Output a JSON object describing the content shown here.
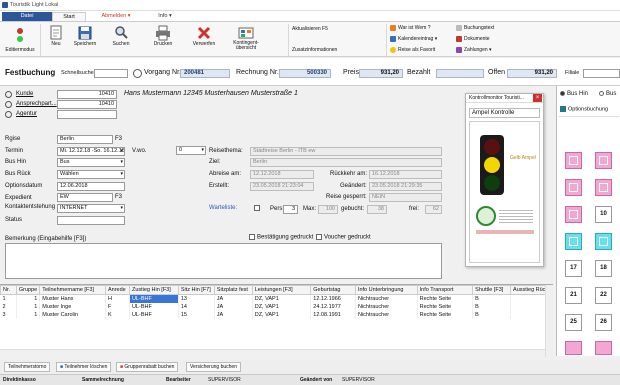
{
  "window": {
    "title": "Touristik Light Lokal"
  },
  "menu": {
    "tabs": [
      "Datei",
      "Start",
      "Abmelden",
      "Info"
    ]
  },
  "ribbon": {
    "editmode": "Editiermodus",
    "buttons": [
      "Neu",
      "Speichern",
      "Suchen",
      "Drucken",
      "Verwerfen",
      "Kontingent-\nübersicht"
    ],
    "mid_items": [
      "Aktualisieren F5",
      "Zusatzinformationen"
    ],
    "right_col1": [
      "War ist Wem ?",
      "Kalendereintrag",
      "Reise als Favorit"
    ],
    "right_col2": [
      "Buchungstext",
      "Dokumente",
      "Zahlungen"
    ]
  },
  "toolbar": {
    "festbuchung": "Festbuchung",
    "schnellsuche_label": "Schnellsuche",
    "schnellsuche_value": "",
    "vorgang_label": "Vorgang Nr.",
    "vorgang_value": "200481",
    "rechnung_label": "Rechnung Nr.",
    "rechnung_value": "500330",
    "preis_label": "Preis",
    "preis_value": "931,20",
    "bezahlt_label": "Bezahlt",
    "bezahlt_value": "",
    "offen_label": "Offen",
    "offen_value": "931,20",
    "filiale_label": "Filiale"
  },
  "form": {
    "kunde_label": "Kunde",
    "kunde_value": "10410",
    "kunde_info": "Hans Mustermann 12345 Musterhausen Musterstraße 1",
    "ansprechpartner_label": "Ansprechpart...",
    "ansprechpartner_value": "10410",
    "agentur_label": "Agentur",
    "agentur_value": "",
    "reise_label": "Rgise",
    "reise_value": "Berlin",
    "reise_key": "F3",
    "termin_label": "Termin",
    "termin_value": "Mi. 12.12.18 -So. 16.12.18  (4)",
    "vwo_label": "V.wo.",
    "vwo_value": "0",
    "bushin_label": "Bus Hin",
    "bushin_value": "Bus",
    "busruck_label": "Bus Rück",
    "busruck_value": "Wählen",
    "optionsdatum_label": "Optionsdatum",
    "optionsdatum_value": "12.06.2018",
    "expedient_label": "Expedient",
    "expedient_value": "EW",
    "expedient_key": "F3",
    "kontakt_label": "Kontaktentstehung",
    "kontakt_value": "INTERNET",
    "status_label": "Status",
    "status_value": "",
    "reisethema_label": "Reisethema:",
    "reisethema_value": "Städtreise Berlin - ITB ew",
    "ziel_label": "Ziel:",
    "ziel_value": "Berlin",
    "abreise_label": "Abreise am:",
    "abreise_value": "12.12.2018",
    "ruckkehr_label": "Rückkehr am:",
    "ruckkehr_value": "16.12.2018",
    "erstellt_label": "Erstellt:",
    "erstellt_value": "23.05.2018 21:23:04",
    "geandert_label": "Geändert:",
    "geandert_value": "23.05.2018 21:29:35",
    "gesperrt_label": "Reise gesperrt:",
    "gesperrt_value": "NEIN",
    "warteliste_label": "Warteliste:",
    "pers_label": "Pers:",
    "pers_value": "3",
    "max_label": "Max:",
    "max_value": "100",
    "gebucht_label": "gebucht:",
    "gebucht_value": "38",
    "frei_label": "frei:",
    "frei_value": "62",
    "bemerkung_label": "Bemerkung (Eingabehilfe [F3])",
    "bestatigung_label": "Bestätigung gedruckt",
    "voucher_label": "Voucher gedruckt"
  },
  "grid": {
    "columns": [
      "Nr.",
      "Gruppe",
      "Teilnehmername [F3]",
      "Anrede",
      "Zustieg Hin [F3]",
      "Sitz Hin [F7]",
      "Sitzplatz fest",
      "Leistungen [F3]",
      "Geburtstag",
      "Info Unterbringung",
      "Info Transport",
      "Shuttle [F3]",
      "Ausstieg Rüc"
    ],
    "rows": [
      [
        "1",
        "1",
        "Muster Hans",
        "H",
        "UL-BHF",
        "13",
        "JA",
        "DZ, VAP1",
        "12.12.1966",
        "Nichtraucher",
        "Rechte Seite",
        "B",
        ""
      ],
      [
        "2",
        "1",
        "Muster Inge",
        "F",
        "UL-BHF",
        "14",
        "JA",
        "DZ, VAP1",
        "24.12.1977",
        "Nichtraucher",
        "Rechte Seite",
        "B",
        ""
      ],
      [
        "3",
        "1",
        "Muster Carolin",
        "K",
        "UL-BHF",
        "15",
        "JA",
        "DZ, VAP1",
        "12.08.1991",
        "Nichtraucher",
        "Rechte Seite",
        "B",
        ""
      ]
    ]
  },
  "buttons": [
    "Teilnehmerstorno",
    "Teilnehmer löschen",
    "Gruppenrabatt buchen",
    "Versicherung buchen"
  ],
  "status": {
    "direktinkasso": "Direktinkasso",
    "sammelrechnung": "Sammelrechnung",
    "bearbeiter_label": "Bearbeiter",
    "bearbeiter_value": "SUPERVISOR",
    "geandert_label": "Geändert von",
    "geandert_value": "SUPERVISOR"
  },
  "kontrollmonitor": {
    "title": "Kontrollmonitor Touristi...",
    "subtitle": "Ampel Kontrolle",
    "badge": "Gelb Ampel"
  },
  "seatpanel": {
    "radio1": "Bus Hin",
    "radio2": "Bus",
    "legend": "Optionsbuchung",
    "seats": [
      "",
      "",
      "",
      "",
      "",
      "10",
      "",
      "",
      "17",
      "18",
      "21",
      "22",
      "25",
      "26",
      "",
      ""
    ]
  },
  "colors": {
    "accent": "#c0392b",
    "datei": "#2b579a",
    "seat_pink": "#f3a6d2",
    "seat_cyan": "#66e0f0"
  }
}
